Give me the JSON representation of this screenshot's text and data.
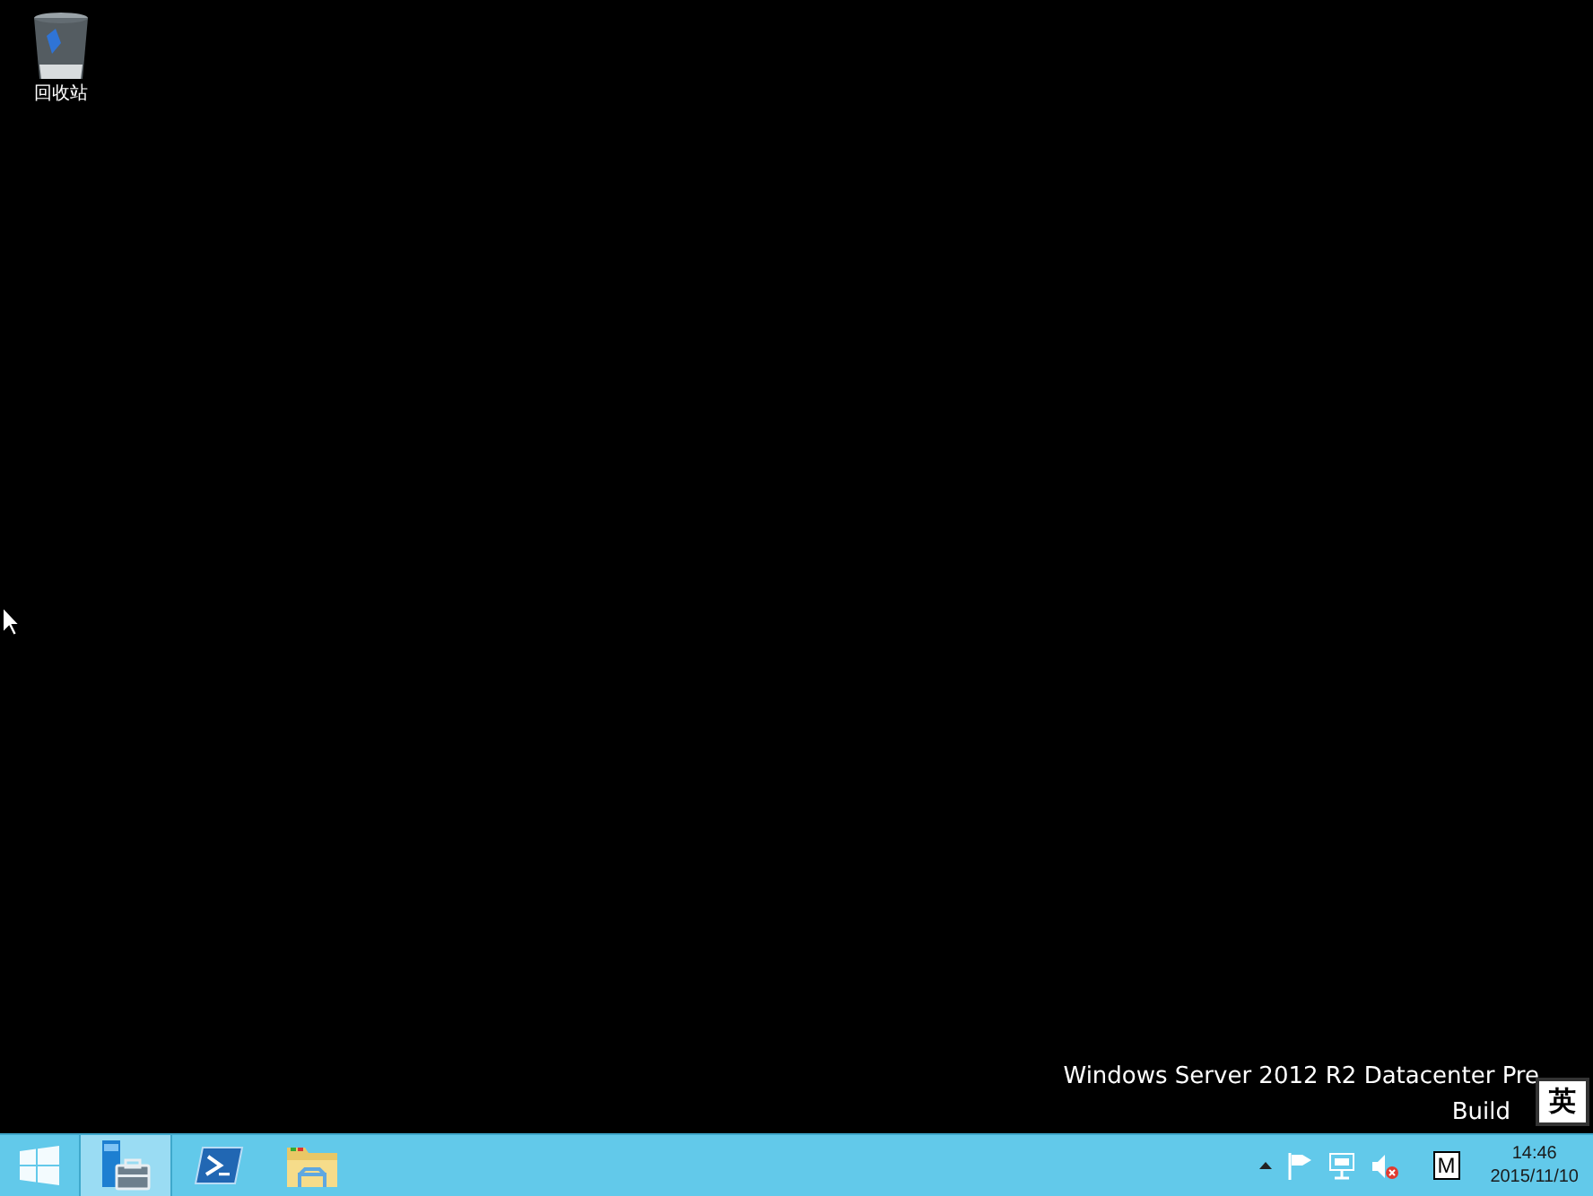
{
  "desktop": {
    "icons": [
      {
        "label": "回收站"
      }
    ],
    "watermark": [
      "Windows Server 2012 R2 Datacenter Pre",
      "Build"
    ]
  },
  "ime_indicator": "英",
  "taskbar": {
    "apps": [
      {
        "kind": "server",
        "selected": true
      },
      {
        "kind": "powershell",
        "selected": false
      },
      {
        "kind": "explorer",
        "selected": false
      }
    ],
    "tray": {
      "ime_mode": "M",
      "time": "14:46",
      "date": "2015/11/10"
    }
  }
}
